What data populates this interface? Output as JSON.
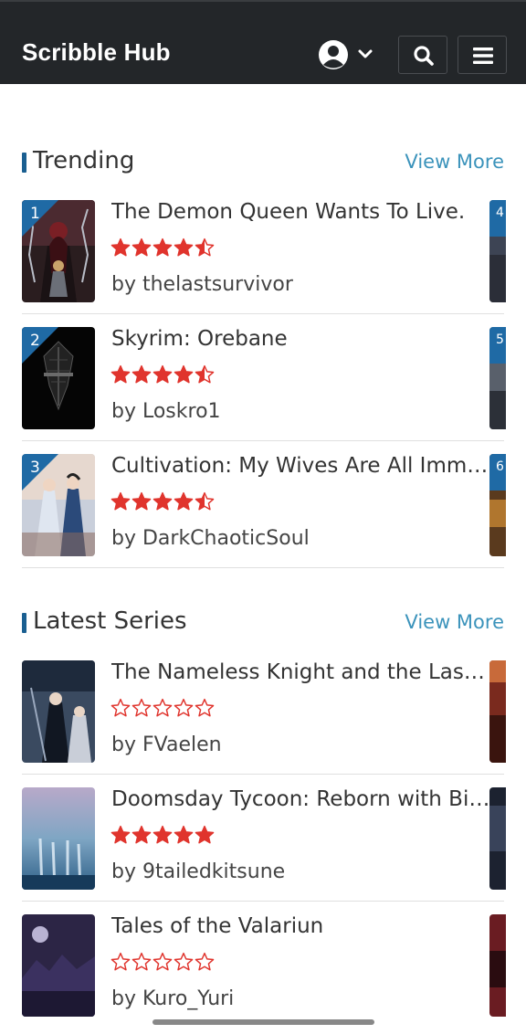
{
  "header": {
    "brand": "Scribble Hub",
    "user_menu_icon": "user-circle-icon",
    "search_icon": "search-icon",
    "menu_icon": "hamburger-icon"
  },
  "trending": {
    "title": "Trending",
    "view_more": "View More",
    "items": [
      {
        "rank": "1",
        "title": "The Demon Queen Wants To Live.",
        "rating": 4.5,
        "author": "by thelastsurvivor",
        "peek_rank": "4"
      },
      {
        "rank": "2",
        "title": "Skyrim: Orebane",
        "rating": 4.5,
        "author": "by Loskro1",
        "peek_rank": "5"
      },
      {
        "rank": "3",
        "title": "Cultivation: My Wives Are All Immo...",
        "rating": 4.5,
        "author": "by DarkChaoticSoul",
        "peek_rank": "6"
      }
    ]
  },
  "latest": {
    "title": "Latest Series",
    "view_more": "View More",
    "items": [
      {
        "title": "The Nameless Knight and the Last ...",
        "rating": 0,
        "author": "by FVaelen"
      },
      {
        "title": "Doomsday Tycoon: Reborn with Bill...",
        "rating": 5,
        "author": "by 9tailedkitsune"
      },
      {
        "title": "Tales of the Valariun",
        "rating": 0,
        "author": "by Kuro_Yuri"
      }
    ]
  },
  "colors": {
    "header_bg": "#232629",
    "accent": "#1a5f91",
    "link": "#3b93bb",
    "star": "#e0342d"
  }
}
